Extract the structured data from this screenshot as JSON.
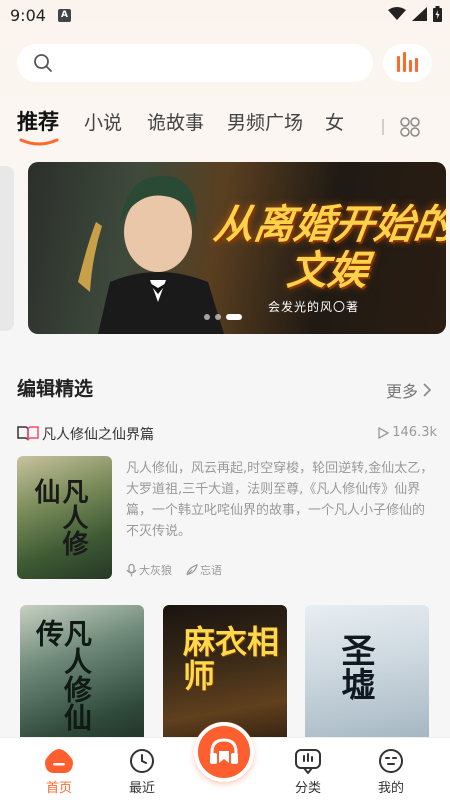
{
  "status_bar": {
    "time": "9:04",
    "notification_badge": "A"
  },
  "search": {
    "placeholder": ""
  },
  "tabs": [
    {
      "label": "推荐",
      "active": true
    },
    {
      "label": "小说",
      "active": false
    },
    {
      "label": "诡故事",
      "active": false
    },
    {
      "label": "男频广场",
      "active": false
    },
    {
      "label": "女",
      "active": false
    }
  ],
  "banner": {
    "title": "从离婚开始的文娱",
    "author": "会发光的风〇著",
    "slide_count": 3,
    "active_slide": 3
  },
  "editor_pick": {
    "title": "编辑精选",
    "more_label": "更多",
    "featured": {
      "title": "凡人修仙之仙界篇",
      "play_count": "146.3k",
      "cover_text": "凡人修仙",
      "description": "凡人修仙，风云再起,时空穿梭，轮回逆转,金仙太乙，大罗道祖,三千大道，法则至尊,《凡人修仙传》仙界篇，一个韩立叱咤仙界的故事，一个凡人小子修仙的不灭传说。",
      "narrator": "大灰狼",
      "author": "忘语"
    },
    "covers": [
      {
        "text": "凡人修仙传"
      },
      {
        "text": "麻衣相师"
      },
      {
        "text": "圣墟"
      }
    ]
  },
  "bottom_nav": {
    "items": [
      {
        "label": "首页",
        "active": true
      },
      {
        "label": "最近",
        "active": false
      },
      {
        "label": "分类",
        "active": false
      },
      {
        "label": "我的",
        "active": false
      }
    ]
  },
  "colors": {
    "accent": "#ff5e2e",
    "tab_underline": "#ff6a2c"
  }
}
